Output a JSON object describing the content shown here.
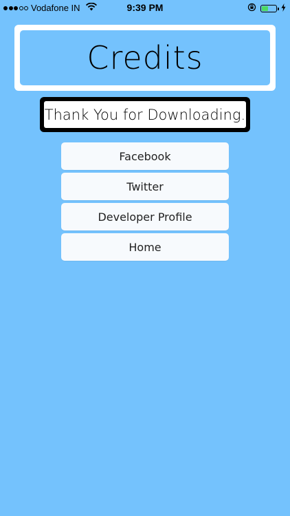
{
  "status_bar": {
    "carrier": "Vodafone IN",
    "time": "9:39 PM",
    "signal_bars": 3,
    "battery_level": 0.45,
    "battery_color": "#4cd964"
  },
  "title": "Credits",
  "banner": "Thank You for Downloading.",
  "buttons": [
    {
      "label": "Facebook"
    },
    {
      "label": "Twitter"
    },
    {
      "label": "Developer Profile"
    },
    {
      "label": "Home"
    }
  ],
  "colors": {
    "background": "#74c2fd",
    "card": "#ffffff",
    "button": "#f7fafd"
  }
}
